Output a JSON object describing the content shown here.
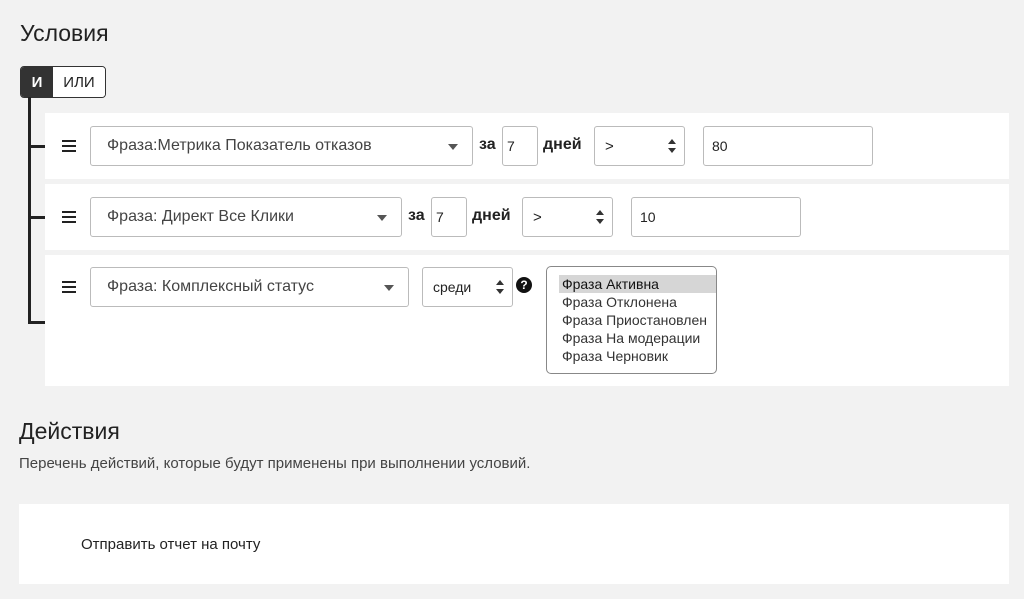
{
  "conditions": {
    "title": "Условия",
    "logic": {
      "and_label": "И",
      "or_label": "ИЛИ",
      "active": "and"
    },
    "rows": [
      {
        "field": "Фраза:Метрика Показатель отказов",
        "period_label": "за",
        "period_value": "7",
        "days_label": "дней",
        "operator": ">",
        "value": "80"
      },
      {
        "field": "Фраза: Директ Все Клики",
        "period_label": "за",
        "period_value": "7",
        "days_label": "дней",
        "operator": ">",
        "value": "10"
      },
      {
        "field": "Фраза: Комплексный статус",
        "operator": "среди",
        "options": [
          "Фраза Активна",
          "Фраза Отклонена",
          "Фраза Приостановлен",
          "Фраза На модерации",
          "Фраза Черновик"
        ],
        "selected_option": "Фраза Активна"
      }
    ]
  },
  "actions": {
    "title": "Действия",
    "description": "Перечень действий, которые будут применены при выполнении условий.",
    "items": [
      "Отправить отчет на почту"
    ]
  }
}
